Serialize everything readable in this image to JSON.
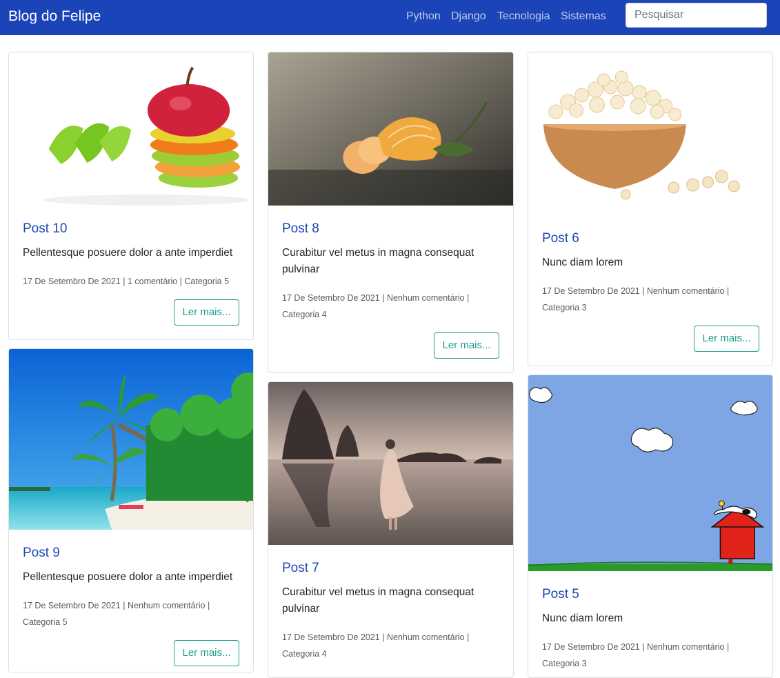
{
  "navbar": {
    "brand": "Blog do Felipe",
    "links": [
      "Python",
      "Django",
      "Tecnologia",
      "Sistemas"
    ],
    "search_placeholder": "Pesquisar"
  },
  "button_label": "Ler mais...",
  "posts": [
    {
      "title": "Post 10",
      "text": "Pellentesque posuere dolor a ante imperdiet",
      "meta": "17 De Setembro De 2021 | 1 comentário | Categoria 5"
    },
    {
      "title": "Post 8",
      "text": "Curabitur vel metus in magna consequat pulvinar",
      "meta": "17 De Setembro De 2021 | Nenhum comentário | Categoria 4"
    },
    {
      "title": "Post 6",
      "text": "Nunc diam lorem",
      "meta": "17 De Setembro De 2021 | Nenhum comentário | Categoria 3"
    },
    {
      "title": "Post 9",
      "text": "Pellentesque posuere dolor a ante imperdiet",
      "meta": "17 De Setembro De 2021 | Nenhum comentário | Categoria 5"
    },
    {
      "title": "Post 7",
      "text": "Curabitur vel metus in magna consequat pulvinar",
      "meta": "17 De Setembro De 2021 | Nenhum comentário | Categoria 4"
    },
    {
      "title": "Post 5",
      "text": "Nunc diam lorem",
      "meta": "17 De Setembro De 2021 | Nenhum comentário | Categoria 3"
    }
  ]
}
